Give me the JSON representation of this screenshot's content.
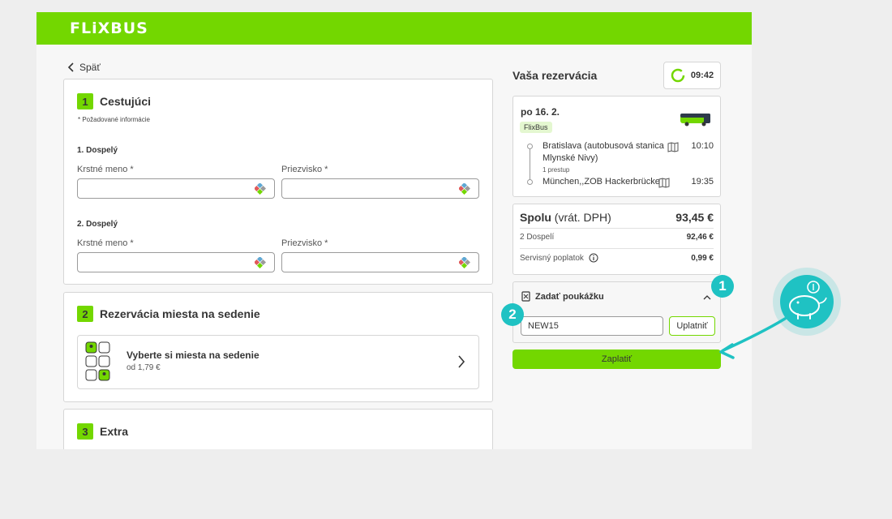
{
  "header": {
    "logo": "FLiXBUS"
  },
  "back": {
    "label": "Späť"
  },
  "passengers": {
    "title": "Cestujúci",
    "step": "1",
    "required_note": "* Požadované informácie",
    "list": [
      {
        "heading": "1. Dospelý",
        "first_name_label": "Krstné meno *",
        "last_name_label": "Priezvisko *"
      },
      {
        "heading": "2. Dospelý",
        "first_name_label": "Krstné meno *",
        "last_name_label": "Priezvisko *"
      }
    ]
  },
  "seats": {
    "step": "2",
    "title": "Rezervácia miesta na sedenie",
    "option_title": "Vyberte si miesta na sedenie",
    "option_price": "od 1,79 €"
  },
  "extra": {
    "step": "3",
    "title": "Extra"
  },
  "sidebar": {
    "title": "Vaša rezervácia",
    "timer": "09:42",
    "trip": {
      "date": "po 16. 2.",
      "badge": "FlixBus",
      "departure_stop": "Bratislava (autobusová stanica Mlynské Nivy)",
      "departure_time": "10:10",
      "transfer": "1 prestup",
      "arrival_stop": "München,,ZOB Hackerbrücke",
      "arrival_time": "19:35"
    },
    "totals": {
      "total_label": "Spolu",
      "total_vat": "(vrát. DPH)",
      "total_value": "93,45 €",
      "adults_label": "2 Dospelí",
      "adults_value": "92,46 €",
      "fee_label": "Servisný poplatok",
      "fee_value": "0,99 €"
    },
    "voucher": {
      "title": "Zadať poukážku",
      "input_value": "NEW15",
      "apply_label": "Uplatniť"
    },
    "pay_label": "Zaplatiť"
  },
  "annotations": {
    "marker1": "1",
    "marker2": "2"
  },
  "colors": {
    "brand_green": "#73d700",
    "annotation_teal": "#1fc2c3"
  },
  "icons": [
    "chevron-left-icon",
    "keyboard-icon",
    "seat-map-icon",
    "chevron-right-icon",
    "timer-icon",
    "bus-icon",
    "map-icon",
    "info-icon",
    "voucher-icon",
    "chevron-up-icon",
    "piggy-bank-icon",
    "arrow-icon"
  ]
}
